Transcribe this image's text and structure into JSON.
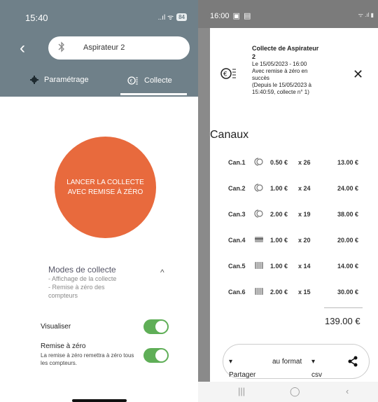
{
  "left": {
    "status": {
      "time": "15:40",
      "icons": "..ıl ᯤ",
      "battery": "84"
    },
    "device": {
      "name": "Aspirateur 2"
    },
    "tabs": {
      "settings": "Paramétrage",
      "collect": "Collecte"
    },
    "launch_button": {
      "line1": "LANCER LA COLLECTE",
      "line2": "AVEC REMISE À ZÉRO"
    },
    "modes": {
      "title": "Modes de collecte",
      "items": [
        "- Affichage de la collecte",
        "- Remise à zéro des",
        "compteurs"
      ]
    },
    "toggles": {
      "visualiser": {
        "label": "Visualiser",
        "on": true
      },
      "reset": {
        "label": "Remise à zéro",
        "sub": "La remise à zéro remettra à zéro tous les compteurs.",
        "on": true
      }
    },
    "colors": {
      "header": "#6f8089",
      "accent": "#e86a3d",
      "toggle": "#5fae57"
    }
  },
  "right": {
    "status": {
      "time": "16:00",
      "icons": "ᯤ .ıl ▮"
    },
    "info": {
      "title_line1": "Collecte de Aspirateur",
      "title_line2": "2",
      "date": "Le 15/05/2023 - 16:00",
      "mode": "Avec remise à zéro en",
      "result": "succès",
      "since_line1": "(Depuis le 15/05/2023 à",
      "since_line2": "15:40:59, collecte n° 1)"
    },
    "section_title": "Canaux",
    "channels": [
      {
        "name": "Can.1",
        "icon": "coin-icon",
        "value": "0.50 €",
        "qty": "x 26",
        "total": "13.00 €"
      },
      {
        "name": "Can.2",
        "icon": "coin-icon",
        "value": "1.00 €",
        "qty": "x 24",
        "total": "24.00 €"
      },
      {
        "name": "Can.3",
        "icon": "coin-icon",
        "value": "2.00 €",
        "qty": "x 19",
        "total": "38.00 €"
      },
      {
        "name": "Can.4",
        "icon": "card-icon",
        "value": "1.00 €",
        "qty": "x 20",
        "total": "20.00 €"
      },
      {
        "name": "Can.5",
        "icon": "token-icon",
        "value": "1.00 €",
        "qty": "x 14",
        "total": "14.00 €"
      },
      {
        "name": "Can.6",
        "icon": "token-icon",
        "value": "2.00 €",
        "qty": "x 15",
        "total": "30.00 €"
      }
    ],
    "grand_total": "139.00 €",
    "share": {
      "share_label": "Partager",
      "format_label": "au format",
      "format_value": "csv"
    }
  }
}
